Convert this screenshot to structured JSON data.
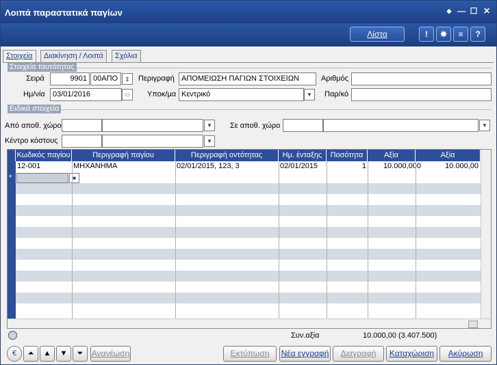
{
  "window": {
    "title": "Λοιπά παραστατικά παγίων",
    "controls": {
      "pin": "◆",
      "minimize": "—",
      "maximize": "☐",
      "close": "✕"
    }
  },
  "toolbar": {
    "list_label": "Λίστα",
    "icons": [
      "info-icon",
      "settings-icon",
      "menu-icon",
      "help-icon"
    ],
    "icon_glyphs": {
      "info": "!",
      "settings": "✸",
      "menu": "≡",
      "help": "?"
    }
  },
  "tabs": [
    "Στοιχεία",
    "Διακίνηση / Λοιπά",
    "Σχόλια"
  ],
  "identity": {
    "section_title": "Στοιχεία ταυτότητας",
    "series_label": "Σειρά",
    "series_code": "9901",
    "series_name": "00ΑΠΟ",
    "description_label": "Περιγραφή",
    "description_value": "ΑΠΟΜΕΙΩΣΗ ΠΑΓΙΩΝ ΣΤΟΙΧΕΙΩΝ",
    "number_label": "Αριθμός",
    "number_value": "",
    "date_label": "Ημ/νία",
    "date_value": "03/01/2016",
    "branch_label": "Υποκ/μα",
    "branch_value": "Κεντρικό",
    "ref_label": "Παρ/κό",
    "ref_value": ""
  },
  "special": {
    "section_title": "Ειδικά στοιχεία",
    "from_warehouse_label": "Από αποθ. χώρο",
    "to_warehouse_label": "Σε αποθ. χώρο",
    "cost_center_label": "Κέντρο κόστους"
  },
  "grid": {
    "columns": [
      "Κωδικός παγίου",
      "Περιγραφή παγίου",
      "Περιγραφή οντότητας",
      "Ημ. ένταξης",
      "Ποσότητα",
      "Αξία",
      "Αξία"
    ],
    "rows": [
      [
        "12-001",
        "ΜΗΧΑΝΗΜΑ",
        "02/01/2015, 123, 3",
        "02/01/2015",
        "1",
        "10.000,000",
        "10.000,00"
      ]
    ],
    "new_row_marker": "*"
  },
  "summary": {
    "label": "Συν.αξία",
    "value": "10.000,00 (3.407.500)"
  },
  "buttons": {
    "currency": "€",
    "refresh": "Ανανέωση",
    "print": "Εκτύπωση",
    "new": "Νέα εγγραφή",
    "delete": "Διαγραφή",
    "save": "Καταχώριση",
    "cancel": "Ακύρωση"
  },
  "colors": {
    "titlebar": "#1d3f86",
    "grid_header": "#2d4f9a",
    "alt_row": "#d5dbe3",
    "link_text": "#1f3e8a"
  }
}
